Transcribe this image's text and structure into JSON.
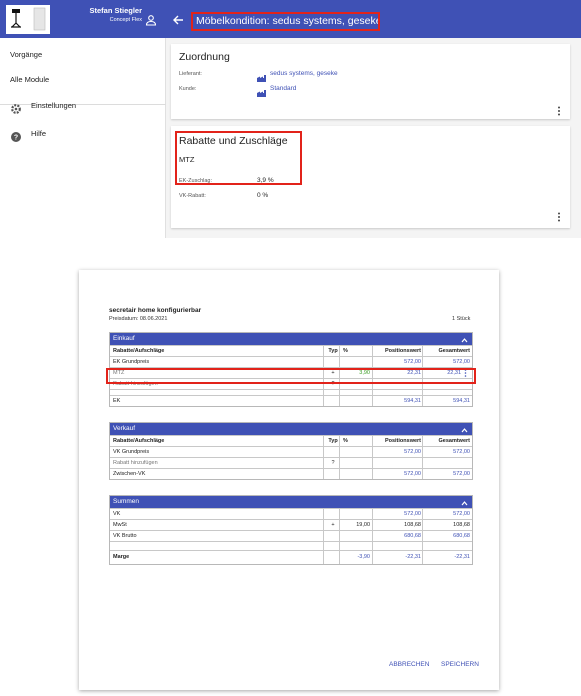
{
  "header": {
    "user_name": "Stefan Stiegler",
    "user_company": "Concept Flex",
    "title": "Möbelkondition: sedus systems, geseke"
  },
  "sidebar": {
    "items": [
      {
        "label": "Vorgänge"
      },
      {
        "label": "Alle Module"
      },
      {
        "label": "Einstellungen",
        "icon": "gear-icon"
      },
      {
        "label": "Hilfe",
        "icon": "help-icon"
      }
    ]
  },
  "zuordnung": {
    "title": "Zuordnung",
    "lieferant_label": "Lieferant:",
    "lieferant_value": "sedus systems, geseke",
    "kunde_label": "Kunde:",
    "kunde_value": "Standard"
  },
  "rabatte": {
    "title": "Rabatte und Zuschläge",
    "subtitle": "MTZ",
    "ek_label": "EK-Zuschlag:",
    "ek_value": "3,9 %",
    "vk_label": "VK-Rabatt:",
    "vk_value": "0 %"
  },
  "dialog": {
    "title": "secretair home konfigurierbar",
    "date": "Preisdatum: 08.06.2021",
    "quantity": "1 Stück",
    "einkauf": {
      "title": "Einkauf",
      "headers": [
        "Rabatte/Aufschläge",
        "Typ",
        "%",
        "Positionswert",
        "Gesamtwert"
      ],
      "rows": [
        {
          "name": "EK Grundpreis",
          "typ": "",
          "pct": "",
          "pos": "572,00",
          "ges": "572,00"
        },
        {
          "name": "MTZ",
          "typ": "+",
          "pct": "3,90",
          "pos": "22,31",
          "ges": "22,31"
        },
        {
          "name": "Rabatt hinzufügen",
          "typ": "?",
          "pct": "",
          "pos": "",
          "ges": ""
        },
        {
          "name": "",
          "typ": "",
          "pct": "",
          "pos": "",
          "ges": ""
        },
        {
          "name": "EK",
          "typ": "",
          "pct": "",
          "pos": "594,31",
          "ges": "594,31"
        }
      ]
    },
    "verkauf": {
      "title": "Verkauf",
      "headers": [
        "Rabatte/Aufschläge",
        "Typ",
        "%",
        "Positionswert",
        "Gesamtwert"
      ],
      "rows": [
        {
          "name": "VK Grundpreis",
          "typ": "",
          "pct": "",
          "pos": "572,00",
          "ges": "572,00"
        },
        {
          "name": "Rabatt hinzufügen",
          "typ": "?",
          "pct": "",
          "pos": "",
          "ges": ""
        },
        {
          "name": "Zwischen-VK",
          "typ": "",
          "pct": "",
          "pos": "572,00",
          "ges": "572,00"
        }
      ]
    },
    "summen": {
      "title": "Summen",
      "rows": [
        {
          "name": "VK",
          "typ": "",
          "pct": "",
          "pos": "572,00",
          "ges": "572,00"
        },
        {
          "name": "MwSt",
          "typ": "+",
          "pct": "19,00",
          "pos": "108,68",
          "ges": "108,68"
        },
        {
          "name": "VK Brutto",
          "typ": "",
          "pct": "",
          "pos": "680,68",
          "ges": "680,68"
        },
        {
          "name": "",
          "typ": "",
          "pct": "",
          "pos": "",
          "ges": ""
        },
        {
          "name": "Marge",
          "typ": "",
          "pct": "-3,90",
          "pos": "-22,31",
          "ges": "-22,31"
        }
      ]
    },
    "cancel_label": "ABBRECHEN",
    "save_label": "SPEICHERN"
  },
  "colors": {
    "primary": "#3f51b5",
    "highlight": "#e2231a",
    "positive": "#3a9d23"
  }
}
